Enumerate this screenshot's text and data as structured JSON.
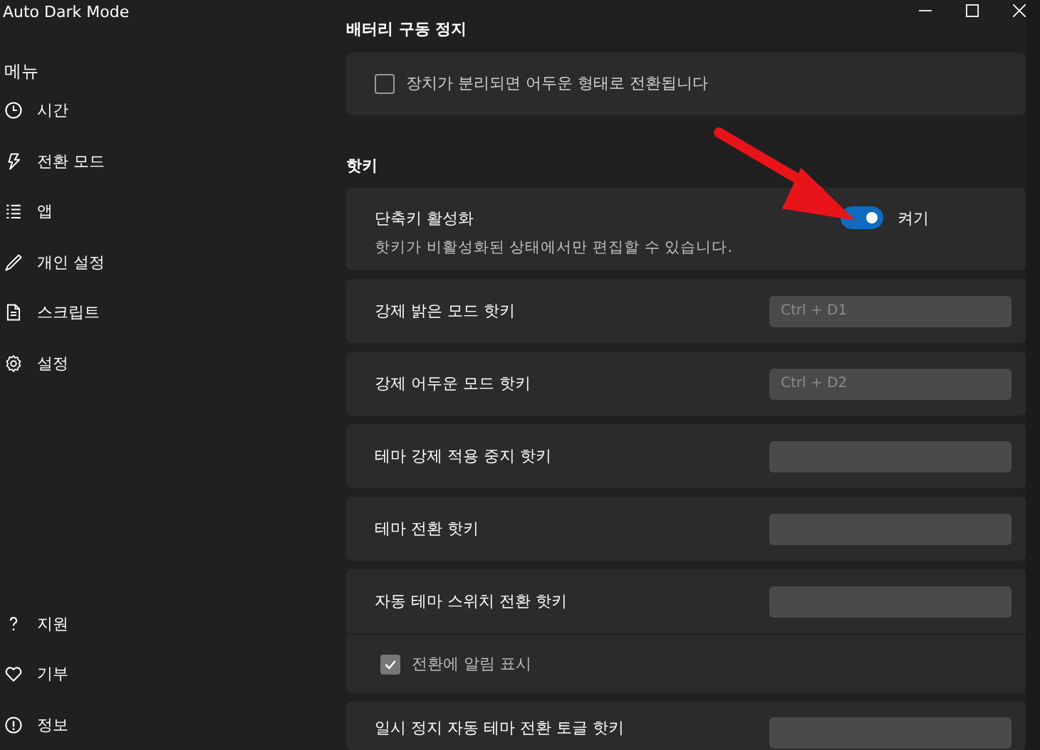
{
  "window": {
    "title": "Auto Dark Mode"
  },
  "sidebar": {
    "header": "메뉴",
    "items": [
      {
        "label": "시간"
      },
      {
        "label": "전환 모드"
      },
      {
        "label": "앱"
      },
      {
        "label": "개인 설정"
      },
      {
        "label": "스크립트"
      },
      {
        "label": "설정"
      }
    ],
    "footer_items": [
      {
        "label": "지원"
      },
      {
        "label": "기부"
      },
      {
        "label": "정보"
      }
    ]
  },
  "battery_section": {
    "title": "배터리 구동 정지",
    "checkbox": {
      "label": "장치가 분리되면 어두운 형태로 전환됩니다",
      "checked": false
    }
  },
  "hotkeys_section": {
    "title": "핫키",
    "enable": {
      "label": "단축키 활성화",
      "description": "핫키가 비활성화된 상태에서만 편집할 수 있습니다.",
      "on": true,
      "state_label": "켜기"
    },
    "rows": [
      {
        "label": "강제 밝은 모드 핫키",
        "value": "Ctrl + D1",
        "disabled": true
      },
      {
        "label": "강제 어두운 모드 핫키",
        "value": "Ctrl + D2",
        "disabled": true
      },
      {
        "label": "테마 강제 적용 중지 핫키",
        "disabled": true
      },
      {
        "label": "테마 전환 핫키",
        "disabled": true
      },
      {
        "label": "자동 테마 스위치 전환 핫키",
        "disabled": true,
        "option": {
          "label": "전환에 알림 표시",
          "checked": true,
          "disabled": true
        }
      },
      {
        "label": "일시 정지 자동 테마 전환 토글 핫키",
        "disabled": true
      }
    ]
  }
}
